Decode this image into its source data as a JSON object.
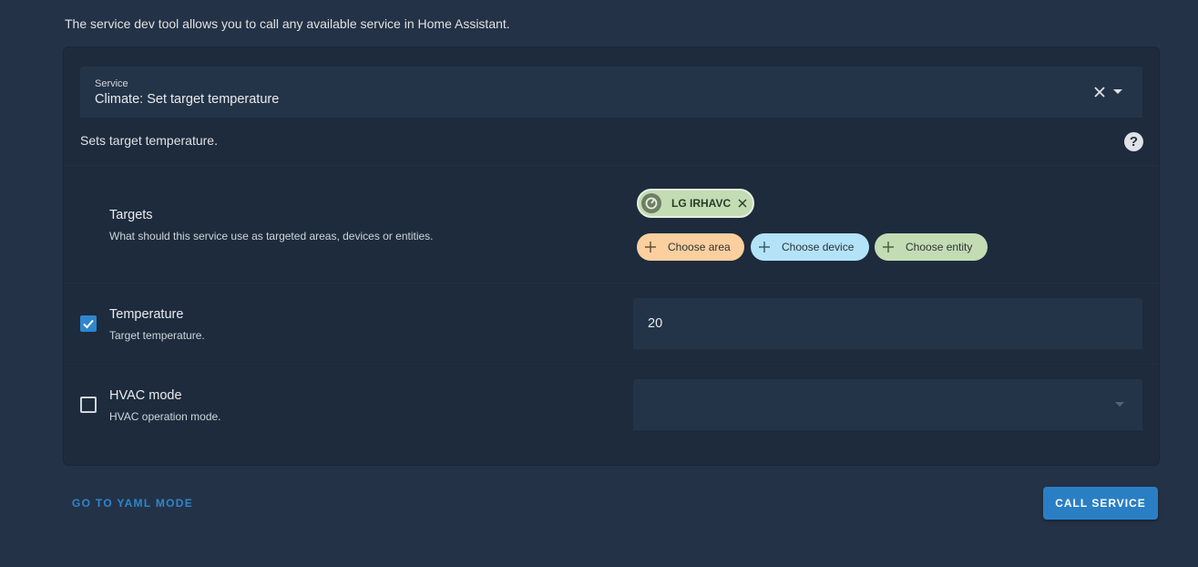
{
  "intro": "The service dev tool allows you to call any available service in Home Assistant.",
  "service": {
    "label": "Service",
    "value": "Climate: Set target temperature",
    "description": "Sets target temperature."
  },
  "targets": {
    "title": "Targets",
    "subtitle": "What should this service use as targeted areas, devices or entities.",
    "selected_entity": "LG IRHAVC",
    "choose_area": "Choose area",
    "choose_device": "Choose device",
    "choose_entity": "Choose entity",
    "colors": {
      "area": "#fbcf9e",
      "device": "#b3e3f9",
      "entity": "#c3dcb3"
    }
  },
  "temperature": {
    "title": "Temperature",
    "subtitle": "Target temperature.",
    "enabled": true,
    "value": "20"
  },
  "hvac_mode": {
    "title": "HVAC mode",
    "subtitle": "HVAC operation mode.",
    "enabled": false,
    "value": ""
  },
  "actions": {
    "yaml_mode": "GO TO YAML MODE",
    "call_service": "CALL SERVICE"
  },
  "accent_color": "#2f86cc"
}
